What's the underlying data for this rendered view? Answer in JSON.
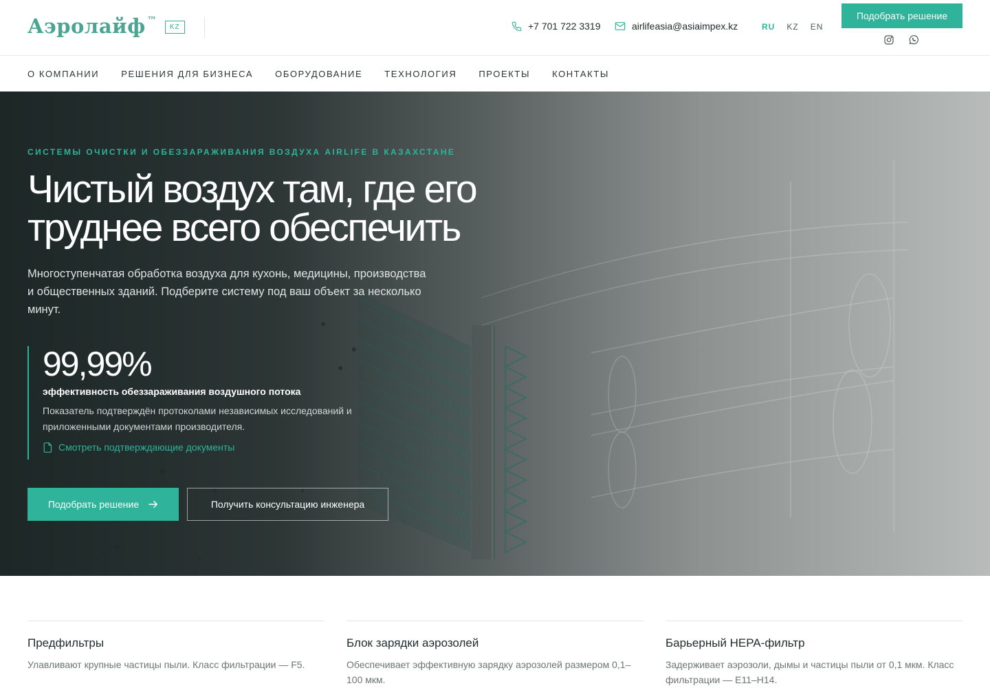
{
  "header": {
    "logo_text": "Аэролайф",
    "logo_tm": "™",
    "logo_badge": "KZ",
    "phone": "+7 701 722 3319",
    "email": "airlifeasia@asiaimpex.kz",
    "languages": [
      "RU",
      "KZ",
      "EN"
    ],
    "active_language": "RU",
    "cta_label": "Подобрать решение",
    "socials": [
      "instagram-icon",
      "whatsapp-icon"
    ]
  },
  "nav": {
    "items": [
      "О КОМПАНИИ",
      "РЕШЕНИЯ ДЛЯ БИЗНЕСА",
      "ОБОРУДОВАНИЕ",
      "ТЕХНОЛОГИЯ",
      "ПРОЕКТЫ",
      "КОНТАКТЫ"
    ]
  },
  "hero": {
    "eyebrow": "СИСТЕМЫ ОЧИСТКИ И ОБЕЗЗАРАЖИВАНИЯ ВОЗДУХА AIRLIFE В КАЗАХСТАНЕ",
    "title_line1": "Чистый воздух там, где его",
    "title_line2": "труднее всего обеспечить",
    "subtitle": "Многоступенчатая обработка воздуха для кухонь, медицины, производства и общественных зданий. Подберите систему под ваш объект за несколько минут.",
    "stat_value": "99,99%",
    "stat_label": "эффективность обеззараживания воздушного потока",
    "stat_note": "Показатель подтверждён протоколами независимых исследований и приложенными документами производителя.",
    "stat_link": "Смотреть подтверждающие документы",
    "primary_button": "Подобрать решение",
    "secondary_button": "Получить консультацию инженера"
  },
  "features": [
    {
      "title": "Предфильтры",
      "desc": "Улавливают крупные частицы пыли. Класс фильтрации — F5."
    },
    {
      "title": "Блок зарядки аэрозолей",
      "desc": "Обеспечивает эффективную зарядку аэрозолей размером 0,1–100 мкм."
    },
    {
      "title": "Барьерный HEPA-фильтр",
      "desc": "Задерживает аэрозоли, дымы и частицы пыли от 0,1 мкм. Класс фильтрации — E11–H14."
    }
  ],
  "colors": {
    "accent": "#2fb39b",
    "hero_dark": "#1f2a29",
    "text": "#1f2a2a"
  }
}
